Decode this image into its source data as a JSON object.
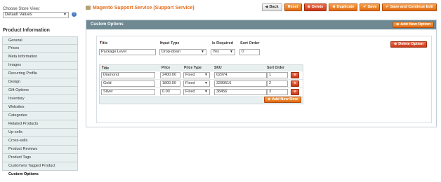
{
  "sidebar": {
    "store_view_label": "Choose Store View:",
    "store_view_value": "Default Values",
    "section_title": "Product Information",
    "tabs": [
      "General",
      "Prices",
      "Meta Information",
      "Images",
      "Recurring Profile",
      "Design",
      "Gift Options",
      "Inventory",
      "Websites",
      "Categories",
      "Related Products",
      "Up-sells",
      "Cross-sells",
      "Product Reviews",
      "Product Tags",
      "Customers Tagged Product",
      "Custom Options"
    ],
    "active_tab": "Custom Options"
  },
  "header": {
    "title": "Magento Support Service (Support Service)",
    "buttons": {
      "back": "Back",
      "reset": "Reset",
      "delete": "Delete",
      "duplicate": "Duplicate",
      "save": "Save",
      "save_continue": "Save and Continue Edit"
    }
  },
  "custom_options": {
    "panel_title": "Custom Options",
    "add_option": "Add New Option",
    "delete_option": "Delete Option",
    "labels": {
      "title": "Title",
      "input_type": "Input Type",
      "is_required": "Is Required",
      "sort_order": "Sort Order"
    },
    "option": {
      "title": "Package Level",
      "input_type": "Drop-down",
      "is_required": "Yes",
      "sort_order": "0"
    },
    "values_headers": {
      "title": "Title",
      "price": "Price",
      "price_type": "Price Type",
      "sku": "SKU",
      "sort_order": "Sort Order"
    },
    "rows": [
      {
        "title": "Diamond",
        "price": "2400.00",
        "price_type": "Fixed",
        "sku": "02974",
        "sort_order": "1"
      },
      {
        "title": "Gold",
        "price": "1800.00",
        "price_type": "Fixed",
        "sku": "3289516",
        "sort_order": "2"
      },
      {
        "title": "Silver",
        "price": "0.00",
        "price_type": "Fixed",
        "sku": "38456",
        "sort_order": "3"
      }
    ],
    "add_row": "Add New Row"
  }
}
